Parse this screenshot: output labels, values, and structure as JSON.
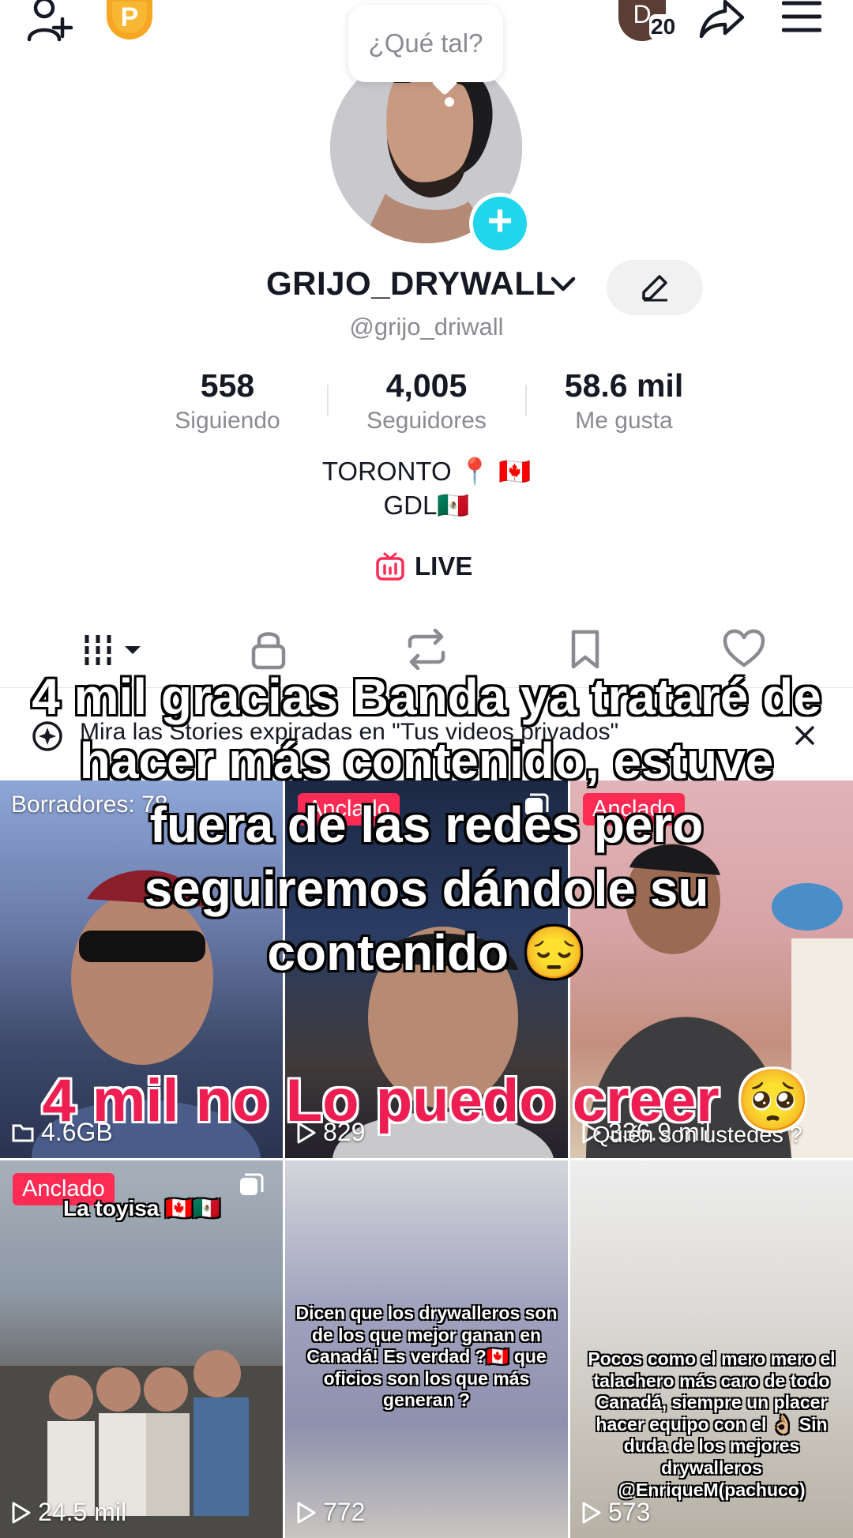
{
  "topbar": {
    "coin_letter": "P",
    "avatar_initial": "D",
    "notification_count": "20"
  },
  "status_bubble": {
    "text": "¿Qué tal?"
  },
  "profile": {
    "display_name": "GRIJO_DRYWALL",
    "handle": "@grijo_driwall",
    "stats": [
      {
        "value": "558",
        "label": "Siguiendo"
      },
      {
        "value": "4,005",
        "label": "Seguidores"
      },
      {
        "value": "58.6 mil",
        "label": "Me gusta"
      }
    ],
    "bio_line1": "TORONTO 📍 🇨🇦",
    "bio_line2": "GDL🇲🇽",
    "live_label": "LIVE"
  },
  "tabs": [
    "videos-icon",
    "lock-icon",
    "repost-icon",
    "bookmark-icon",
    "heart-icon"
  ],
  "banner": {
    "text": "Mira las Stories expiradas en \"Tus videos privados\""
  },
  "grid": [
    {
      "top_label": "Borradores: 78",
      "bottom_label": "4.6GB"
    },
    {
      "pin": "Anclado",
      "views": "829"
    },
    {
      "pin": "Anclado",
      "caption": "Quién son ustedes ?",
      "views": "336.9 mil"
    },
    {
      "pin": "Anclado",
      "caption": "La toyisa 🇨🇦🇲🇽",
      "views": "24.5 mil"
    },
    {
      "caption": "Dicen que los drywalleros son de los que mejor ganan en Canadá! Es verdad ?🇨🇦 que oficios son los que más generan ?",
      "views": "772"
    },
    {
      "caption": "Pocos como el mero mero el talachero más caro de todo Canadá, siempre un placer hacer equipo con el 👌🏼 Sin duda de los mejores drywalleros @EnriqueM(pachuco)",
      "views": "573"
    }
  ],
  "overlay": {
    "main_text": "4 mil gracias Banda ya trataré de hacer más contenido, estuve fuera de las redes pero seguiremos dándole su contenido 😔",
    "red_text": "4 mil no Lo puedo creer 🥺"
  },
  "colors": {
    "accent": "#fe2c55",
    "add_badge": "#20d5ec",
    "coin": "#f5a623"
  }
}
